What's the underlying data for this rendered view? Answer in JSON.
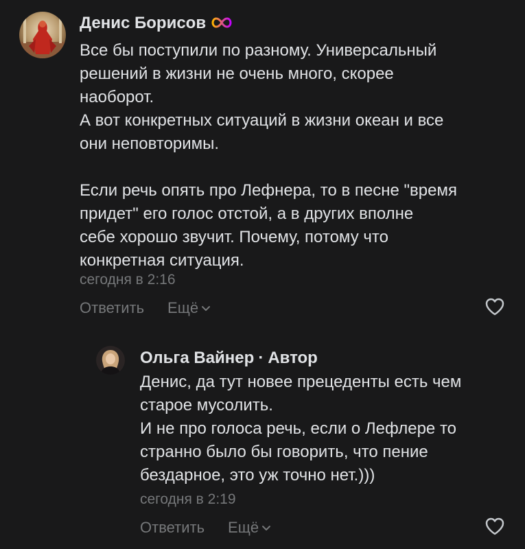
{
  "comments": [
    {
      "author": "Денис Борисов",
      "author_badge_icon": "infinity-icon",
      "text_lines": [
        "Все бы поступили по разному. Универсальный",
        "решений в жизни не очень много, скорее",
        "наоборот.",
        "А вот конкретных ситуаций в жизни океан и все",
        "они неповторимы.",
        "",
        "Если речь опять про Лефнера, то в песне \"время",
        "придет\" его голос отстой, а в других вполне",
        "себе хорошо звучит. Почему, потому что",
        "конкретная ситуация."
      ],
      "time": "сегодня в 2:16",
      "reply_label": "Ответить",
      "more_label": "Ещё"
    },
    {
      "author": "Ольга Вайнер",
      "separator": "·",
      "author_role": "Автор",
      "text_lines": [
        "Денис, да тут новее прецеденты есть чем",
        "старое мусолить.",
        "И не про голоса речь, если о Лефлере то",
        "странно было бы говорить, что пение",
        "бездарное, это уж точно нет.)))"
      ],
      "time": "сегодня в 2:19",
      "reply_label": "Ответить",
      "more_label": "Ещё"
    }
  ],
  "colors": {
    "background": "#19191a",
    "text": "#e1e3e6",
    "secondary": "#76787a",
    "badge_gradient": [
      "#ffb400",
      "#c200ff"
    ]
  }
}
